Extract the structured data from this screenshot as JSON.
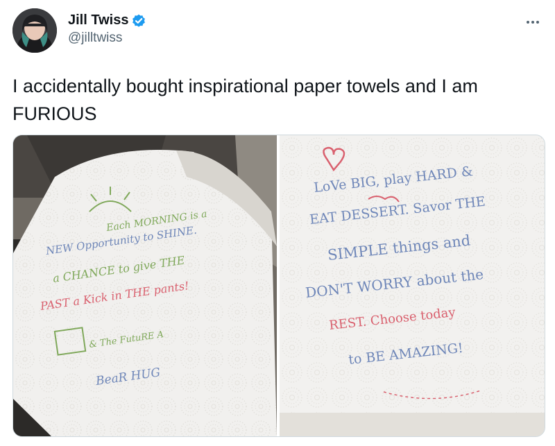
{
  "tweet": {
    "author": {
      "display_name": "Jill Twiss",
      "handle": "@jilltwiss",
      "verified_icon": "verified-badge-icon",
      "avatar": "profile-photo"
    },
    "more_icon": "more-dots-icon",
    "text": "I accidentally bought inspirational paper towels and I am FURIOUS",
    "media": [
      {
        "kind": "photo",
        "subject": "paper towel roll",
        "printed_lines": [
          "Each MORNING is a",
          "NEW Opportunity to SHINE.",
          "a CHANCE to give THE",
          "PAST a Kick in THE pants!",
          "& The FutuRE A",
          "BeaR HUG"
        ]
      },
      {
        "kind": "photo",
        "subject": "paper towel sheet",
        "printed_lines": [
          "LoVe BIG, play HARD &",
          "EAT DESSERT. Savor THE",
          "SIMPLE things and",
          "DON'T WORRY about the",
          "REST. Choose today",
          "to BE AMAZING!"
        ]
      }
    ]
  },
  "colors": {
    "text": "#0f1419",
    "secondary": "#536471",
    "verified": "#1d9bf0",
    "green_print": "#7fa85a",
    "blue_print": "#6e86b8",
    "red_print": "#d9606e"
  }
}
